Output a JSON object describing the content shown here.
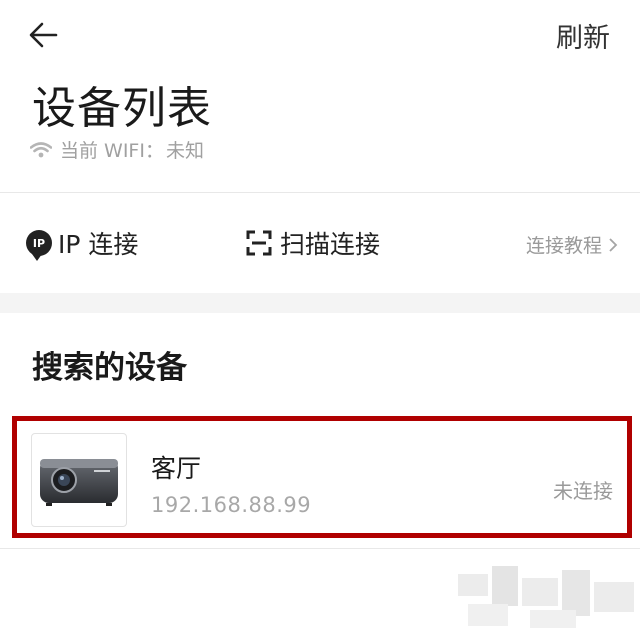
{
  "header": {
    "back_icon": "arrow-left-icon",
    "refresh_label": "刷新",
    "title": "设备列表",
    "wifi_icon": "wifi-icon",
    "wifi_label": "当前 WIFI：",
    "wifi_value": "未知"
  },
  "connect": {
    "ip_icon_text": "IP",
    "ip_label": "IP 连接",
    "scan_icon": "scan-icon",
    "scan_label": "扫描连接",
    "tutorial_label": "连接教程"
  },
  "search": {
    "section_title": "搜索的设备",
    "devices": [
      {
        "name": "客厅",
        "ip": "192.168.88.99",
        "status": "未连接",
        "thumbnail_icon": "projector-icon"
      }
    ]
  },
  "colors": {
    "highlight": "#b00000",
    "muted_text": "#9a9a9a",
    "section_gap": "#f4f4f4"
  }
}
